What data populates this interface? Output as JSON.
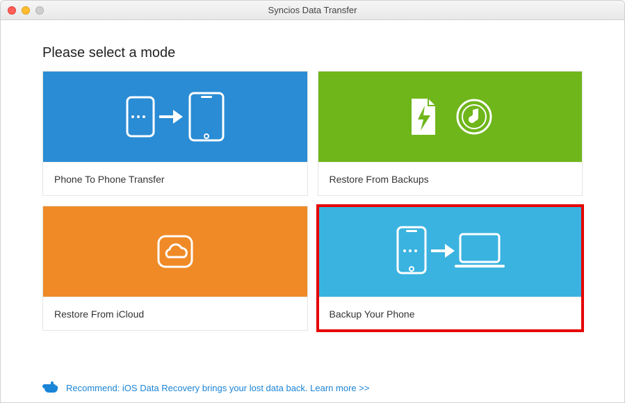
{
  "window": {
    "title": "Syncios Data Transfer"
  },
  "heading": "Please select a mode",
  "tiles": {
    "phone_to_phone": {
      "label": "Phone To Phone Transfer"
    },
    "restore_backups": {
      "label": "Restore From Backups"
    },
    "restore_icloud": {
      "label": "Restore From iCloud"
    },
    "backup_phone": {
      "label": "Backup Your Phone"
    }
  },
  "footer": {
    "recommend_prefix": "Recommend: iOS Data Recovery brings your lost data back. ",
    "learn_more": "Learn more >>"
  }
}
